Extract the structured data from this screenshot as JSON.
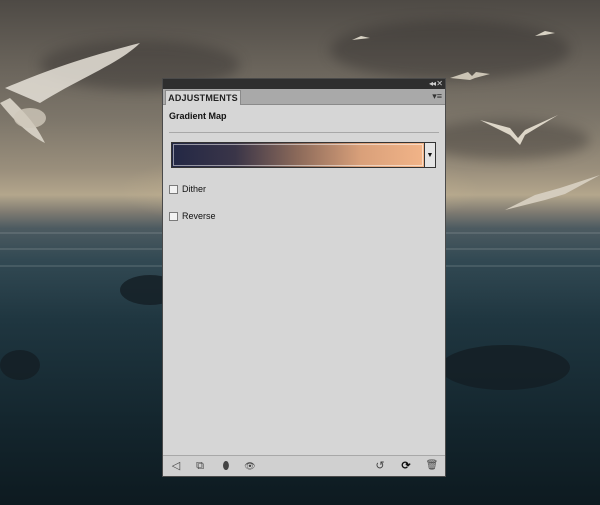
{
  "panel": {
    "tab_label": "ADJUSTMENTS",
    "collapse_glyph": "◂◂",
    "close_glyph": "✕",
    "menu_glyph": "▾≡",
    "heading": "Gradient Map",
    "gradient": {
      "stops": [
        "#232846",
        "#3a3548",
        "#8c6a5a",
        "#d9a07a",
        "#f2b488"
      ],
      "dropdown_glyph": "▼"
    },
    "options": [
      {
        "label": "Dither",
        "checked": false
      },
      {
        "label": "Reverse",
        "checked": false
      }
    ],
    "bottom_icons": [
      {
        "name": "back-arrow-icon",
        "glyph": "◁"
      },
      {
        "name": "clip-to-layer-icon",
        "glyph": "⧉"
      },
      {
        "name": "mask-icon",
        "glyph": "⬮"
      },
      {
        "name": "eye-icon",
        "glyph": "👁"
      },
      {
        "name": "view-previous-icon",
        "glyph": "↺"
      },
      {
        "name": "reset-icon",
        "glyph": "⟳"
      },
      {
        "name": "trash-icon",
        "glyph": "🗑"
      }
    ]
  },
  "colors": {
    "panel_bg": "#d6d6d6",
    "titlebar_bg": "#2e2e2e",
    "tabstrip_bg": "#a9a9a9"
  }
}
